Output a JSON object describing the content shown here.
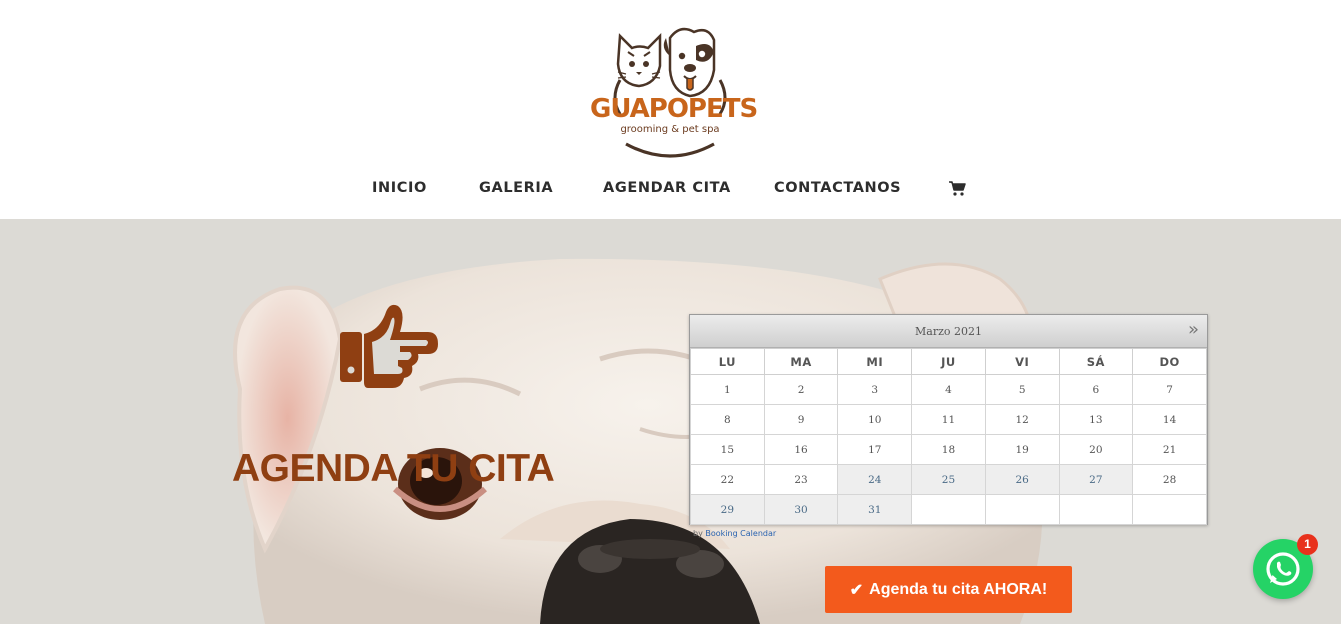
{
  "brand": {
    "name": "GUAPOPETS",
    "tagline": "grooming & pet spa",
    "colors": {
      "primary": "#c8651b",
      "dark": "#6b3b1f"
    }
  },
  "nav": {
    "items": [
      {
        "label": "INICIO"
      },
      {
        "label": "GALERIA"
      },
      {
        "label": "AGENDAR CITA"
      },
      {
        "label": "CONTACTANOS"
      }
    ],
    "cart_icon": "shopping-cart-icon"
  },
  "hero": {
    "icon": "hand-point-right-icon",
    "title": "AGENDA TU CITA",
    "title_color": "#8f3f12"
  },
  "calendar": {
    "month": "Marzo 2021",
    "next_label": "»",
    "weekdays": [
      "LU",
      "MA",
      "MI",
      "JU",
      "VI",
      "SÁ",
      "DO"
    ],
    "weeks": [
      [
        "1",
        "2",
        "3",
        "4",
        "5",
        "6",
        "7"
      ],
      [
        "8",
        "9",
        "10",
        "11",
        "12",
        "13",
        "14"
      ],
      [
        "15",
        "16",
        "17",
        "18",
        "19",
        "20",
        "21"
      ],
      [
        "22",
        "23",
        "24",
        "25",
        "26",
        "27",
        "28"
      ],
      [
        "29",
        "30",
        "31",
        "",
        "",
        "",
        ""
      ]
    ],
    "credit_prefix": "by",
    "credit_link": "Booking Calendar"
  },
  "cta": {
    "label": "Agenda tu cita AHORA!",
    "icon": "check-icon",
    "color": "#f35a1c"
  },
  "whatsapp": {
    "icon": "whatsapp-icon",
    "badge": "1"
  }
}
